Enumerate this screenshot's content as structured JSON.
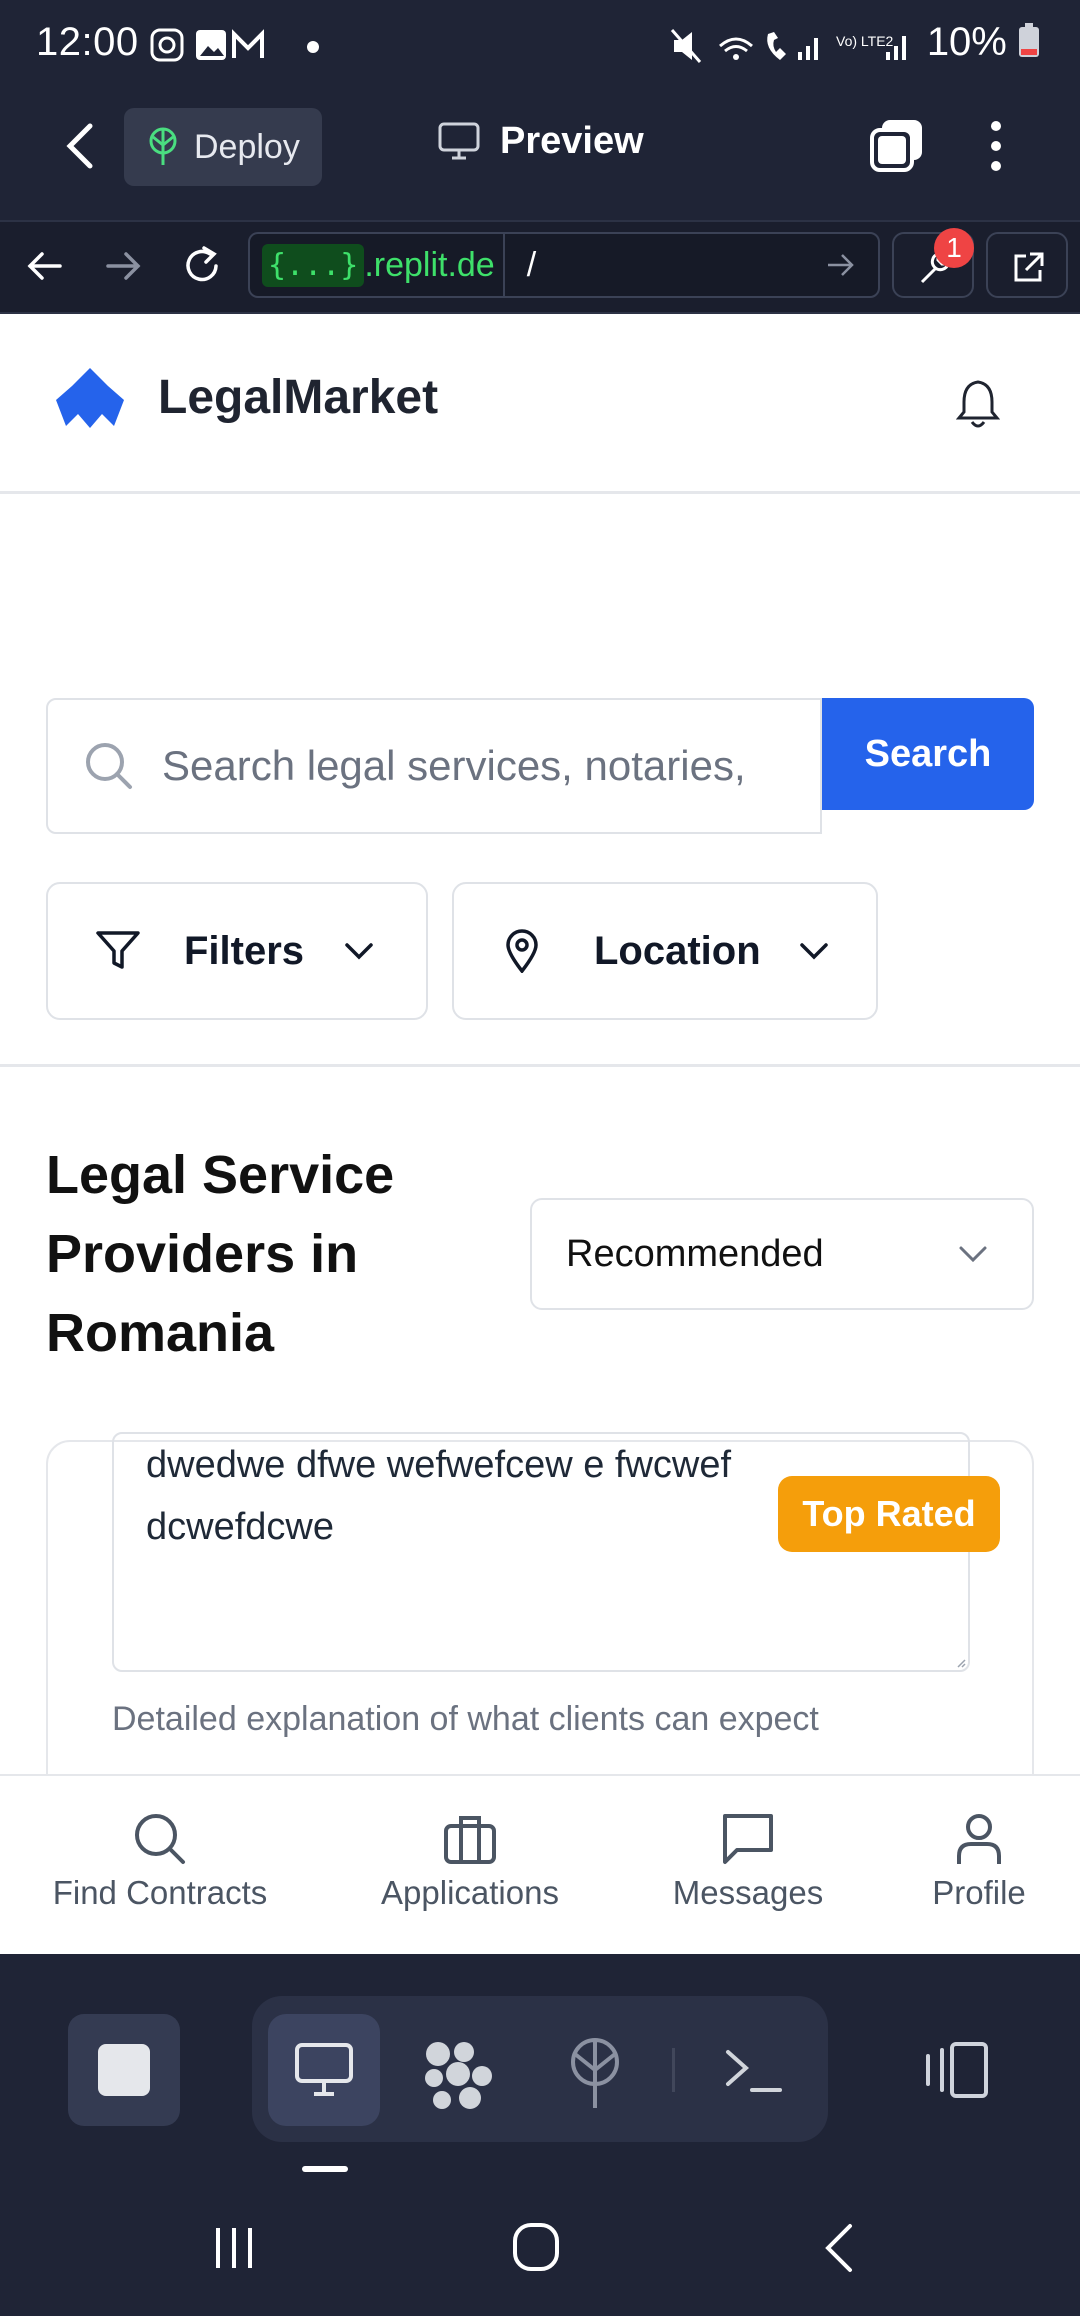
{
  "status_bar": {
    "time": "12:00",
    "battery": "10%",
    "network_label": "Vo) LTE2"
  },
  "replit": {
    "deploy_label": "Deploy",
    "preview_label": "Preview",
    "url_host_chip": "{...}",
    "url_host": ".replit.de",
    "url_path": "/",
    "notifications_badge": "1"
  },
  "app": {
    "brand": "LegalMarket",
    "search": {
      "placeholder": "Search legal services, notaries,",
      "button_label": "Search"
    },
    "filters_label": "Filters",
    "location_label": "Location",
    "section_title": "Legal Service Providers in Romania",
    "sort": {
      "selected": "Recommended"
    },
    "card": {
      "description": "dwedwe dfwe wefwefcew e fwcwef dcwefdcwe",
      "badge": "Top Rated",
      "hint": "Detailed explanation of what clients can expect"
    },
    "bottom_nav": [
      {
        "label": "Find Contracts",
        "icon": "search-icon"
      },
      {
        "label": "Applications",
        "icon": "briefcase-icon"
      },
      {
        "label": "Messages",
        "icon": "message-icon"
      },
      {
        "label": "Profile",
        "icon": "user-icon"
      }
    ]
  },
  "colors": {
    "brand_blue": "#2563eb",
    "badge_amber": "#f59e0b",
    "replit_bg": "#1f2436"
  }
}
